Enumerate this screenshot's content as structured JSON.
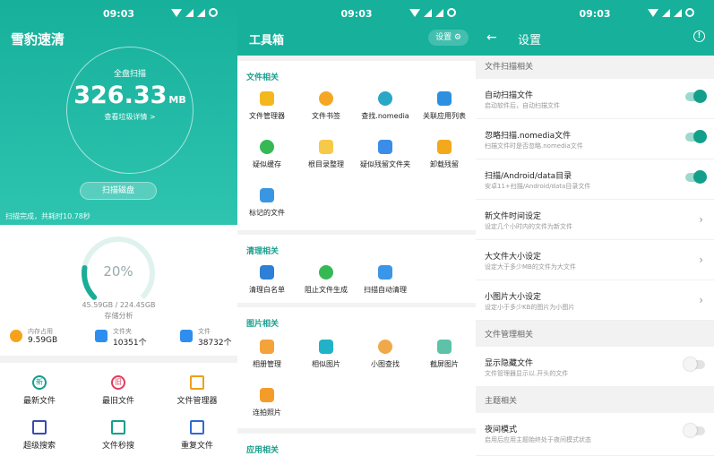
{
  "status": {
    "time": "09:03"
  },
  "home": {
    "app_title": "雪豹速清",
    "scan_label": "全盘扫描",
    "junk_size": "326.33",
    "junk_unit": "MB",
    "view_detail": "查看垃圾详情 >",
    "scan_button": "扫描磁盘",
    "scan_info": "扫描完成，共耗时10.78秒",
    "storage_percent": "20%",
    "storage_fraction": 0.2,
    "storage_used": "45.59GB / 224.45GB",
    "storage_analysis": "存储分析",
    "stats": [
      {
        "label": "内存占用",
        "value": "9.59GB"
      },
      {
        "label": "文件夹",
        "value": "10351个"
      },
      {
        "label": "文件",
        "value": "38732个"
      }
    ],
    "tools": [
      {
        "label": "最新文件",
        "glyph": "新"
      },
      {
        "label": "最旧文件",
        "glyph": "旧"
      },
      {
        "label": "文件管理器",
        "glyph": ""
      },
      {
        "label": "超级搜索",
        "glyph": ""
      },
      {
        "label": "文件秒搜",
        "glyph": ""
      },
      {
        "label": "重复文件",
        "glyph": ""
      }
    ]
  },
  "toolbox": {
    "title": "工具箱",
    "settings_button": "设置 ⚙",
    "sections": [
      {
        "title": "文件相关",
        "items": [
          "文件管理器",
          "文件书签",
          "查找.nomedia",
          "关联应用列表",
          "疑似缓存",
          "根目录整理",
          "疑似残留文件夹",
          "卸载残留",
          "标记的文件"
        ]
      },
      {
        "title": "清理相关",
        "items": [
          "清理白名单",
          "阻止文件生成",
          "扫描自动清理"
        ]
      },
      {
        "title": "图片相关",
        "items": [
          "相册管理",
          "相似图片",
          "小图查找",
          "截屏图片",
          "连拍照片"
        ]
      },
      {
        "title": "应用相关",
        "items": []
      }
    ]
  },
  "settings": {
    "back_icon": "←",
    "title": "设置",
    "info_icon": "!",
    "groups": [
      {
        "title": "文件扫描相关",
        "rows": [
          {
            "title": "自动扫描文件",
            "sub": "启动软件后，自动扫描文件",
            "type": "toggle",
            "on": true
          },
          {
            "title": "忽略扫描.nomedia文件",
            "sub": "扫描文件时是否忽略.nomedia文件",
            "type": "toggle",
            "on": true
          },
          {
            "title": "扫描/Android/data目录",
            "sub": "安卓11+扫描/Android/data目录文件",
            "type": "toggle",
            "on": true
          },
          {
            "title": "新文件时间设定",
            "sub": "设定几个小时内的文件为新文件",
            "type": "chevron"
          },
          {
            "title": "大文件大小设定",
            "sub": "设定大于多少MB的文件为大文件",
            "type": "chevron"
          },
          {
            "title": "小图片大小设定",
            "sub": "设定小于多少KB的图片为小图片",
            "type": "chevron"
          }
        ]
      },
      {
        "title": "文件管理相关",
        "rows": [
          {
            "title": "显示隐藏文件",
            "sub": "文件管理器显示以.开头的文件",
            "type": "toggle",
            "on": false
          }
        ]
      },
      {
        "title": "主题相关",
        "rows": [
          {
            "title": "夜间模式",
            "sub": "启用后应用主题始终处于夜间模式状态",
            "type": "toggle",
            "on": false
          }
        ]
      }
    ]
  },
  "colors": {
    "accent": "#16b09b",
    "section_title": "#1a9e8d"
  }
}
